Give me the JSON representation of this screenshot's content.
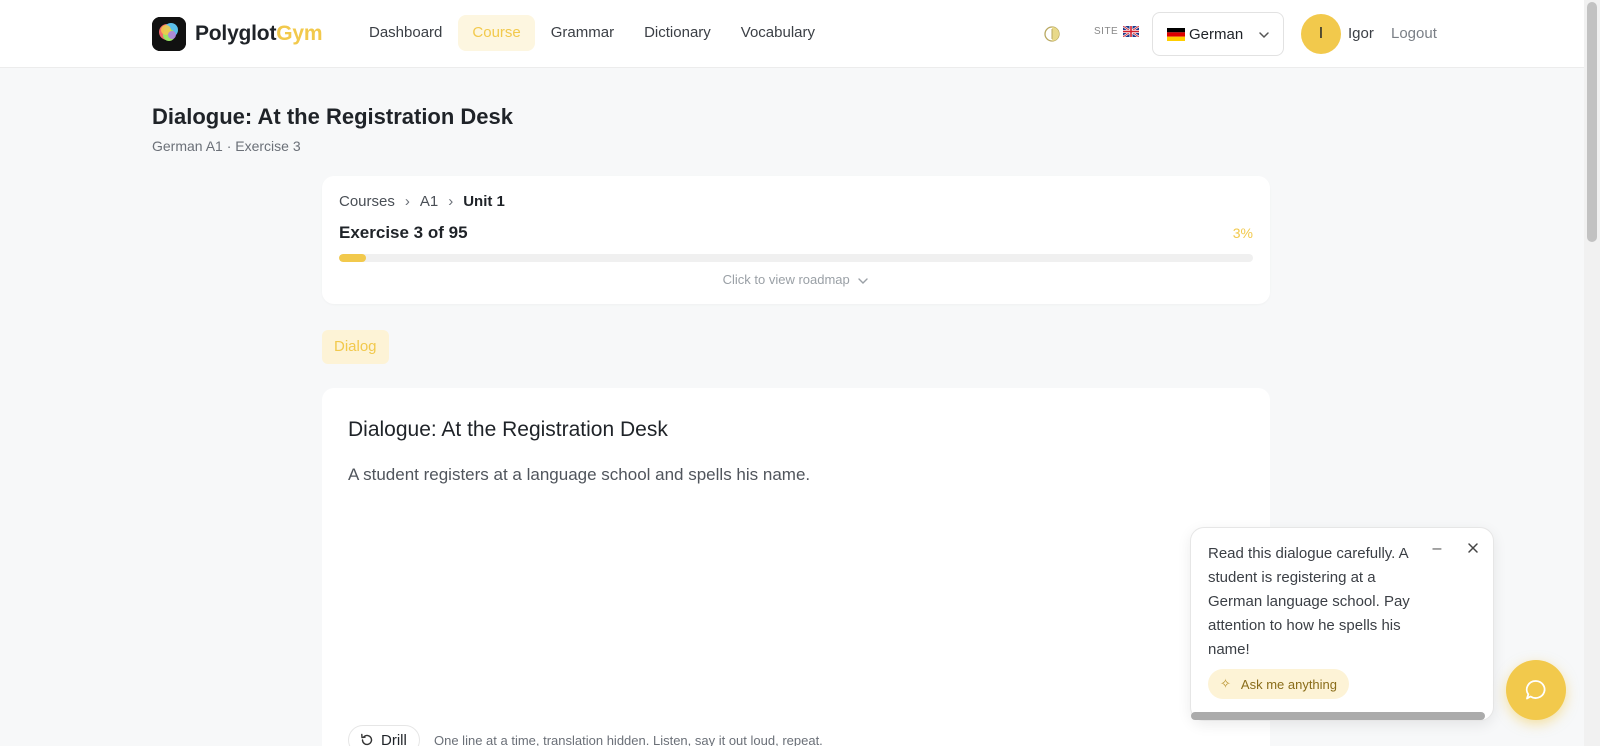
{
  "app": {
    "name_part1": "Polyglot",
    "name_part2": "Gym"
  },
  "nav": [
    {
      "label": "Dashboard",
      "active": false
    },
    {
      "label": "Course",
      "active": true
    },
    {
      "label": "Grammar",
      "active": false
    },
    {
      "label": "Dictionary",
      "active": false
    },
    {
      "label": "Vocabulary",
      "active": false
    }
  ],
  "header": {
    "site_label": "SITE",
    "language": "German",
    "user_initial": "I",
    "user_name": "Igor",
    "logout": "Logout"
  },
  "page": {
    "title": "Dialogue: At the Registration Desk",
    "subtitle": "German A1 · Exercise 3"
  },
  "progress": {
    "breadcrumbs": [
      "Courses",
      "A1",
      "Unit 1"
    ],
    "separator": "›",
    "exercise_label": "Exercise 3 of 95",
    "percent_label": "3%",
    "percent_value": 0.03,
    "roadmap": "Click to view roadmap"
  },
  "tag": "Dialog",
  "dialogue": {
    "title": "Dialogue: At the Registration Desk",
    "description": "A student registers at a language school and spells his name.",
    "drill_label": "Drill",
    "drill_note": "One line at a time, translation hidden. Listen, say it out loud, repeat."
  },
  "tip": {
    "text": "Read this dialogue carefully. A student is registering at a German language school. Pay attention to how he spells his name!",
    "minimize": "–",
    "ask_label": "Ask me anything"
  },
  "colors": {
    "accent": "#f2c94c",
    "accent_soft": "#fdf3d6"
  },
  "icons": [
    "theme-toggle-icon",
    "uk-flag-icon",
    "german-flag-icon",
    "chevron-down-icon",
    "refresh-icon",
    "close-icon",
    "sparkle-icon",
    "chat-icon"
  ]
}
